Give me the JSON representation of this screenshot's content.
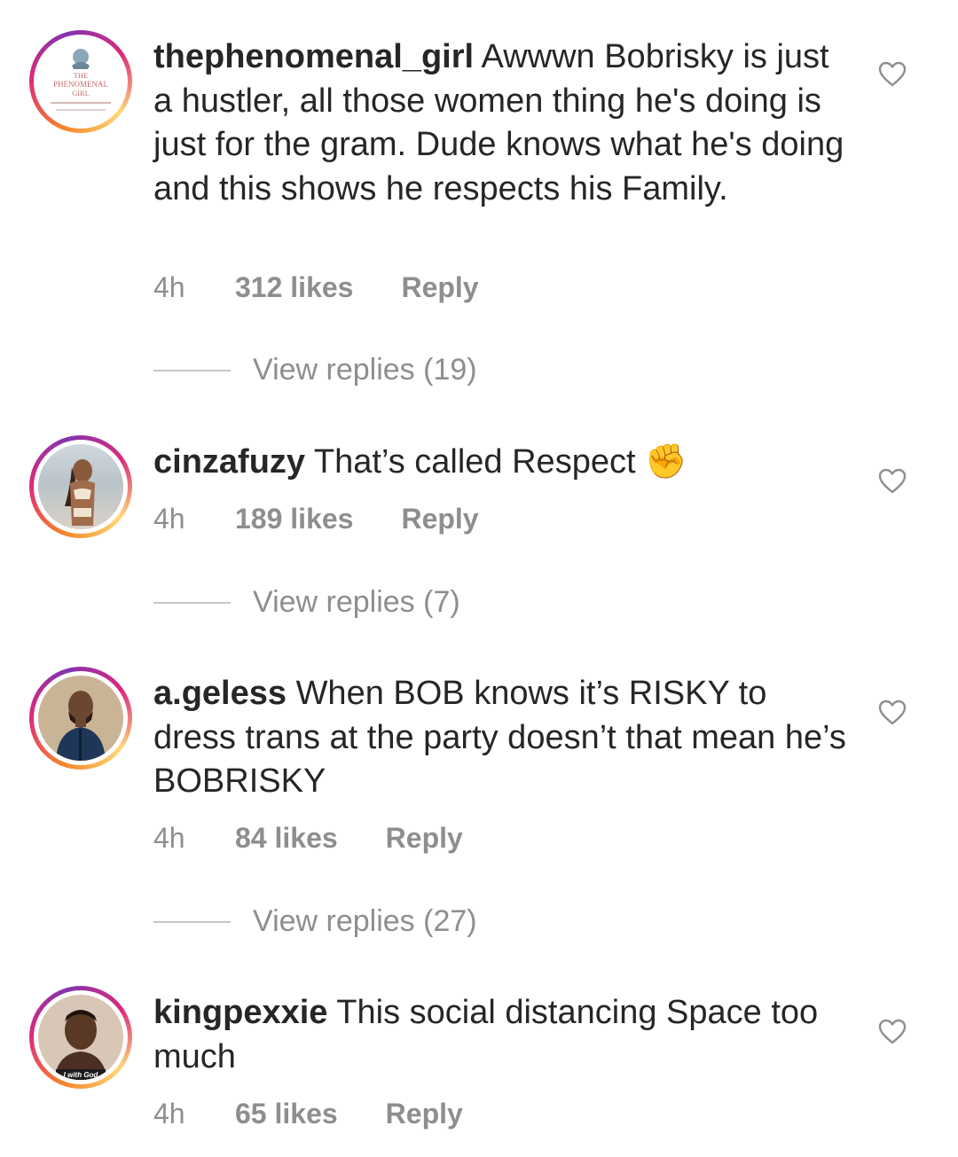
{
  "comments": [
    {
      "username": "thephenomenal_girl",
      "text": "Awwwn Bobrisky is just a hustler, all those women thing he's doing is just for the gram. Dude knows what he's doing and this shows he respects his Family.",
      "time": "4h",
      "likes": "312 likes",
      "reply": "Reply",
      "view_replies": "View replies (19)",
      "avatar": {
        "logo_line1": "THE",
        "logo_line2": "PHENOMENAL",
        "logo_line3": "GIRL"
      }
    },
    {
      "username": "cinzafuzy",
      "text": "That’s called Respect ✊",
      "time": "4h",
      "likes": "189 likes",
      "reply": "Reply",
      "view_replies": "View replies (7)"
    },
    {
      "username": "a.geless",
      "text": "When BOB knows it’s RISKY to dress trans at the party doesn’t that mean he’s BOBRISKY",
      "time": "4h",
      "likes": "84 likes",
      "reply": "Reply",
      "view_replies": "View replies (27)"
    },
    {
      "username": "kingpexxie",
      "text": "This social distancing Space too much",
      "time": "4h",
      "likes": "65 likes",
      "reply": "Reply",
      "avatar": {
        "caption": "I with God"
      }
    }
  ],
  "icons": {
    "like": "heart-outline-icon",
    "story_ring": "story-ring-gradient"
  },
  "colors": {
    "text": "#262626",
    "secondary": "#8e8e8e",
    "divider": "#c7c7c7"
  }
}
